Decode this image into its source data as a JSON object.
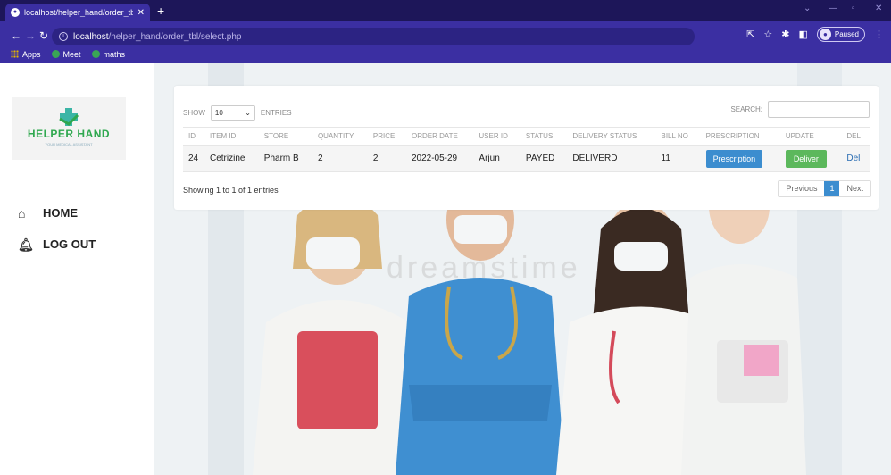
{
  "browser": {
    "tab_title": "localhost/helper_hand/order_tbl/s",
    "url_host": "localhost",
    "url_path": "/helper_hand/order_tbl/select.php",
    "profile_label": "Paused",
    "bookmarks": [
      {
        "label": "Apps",
        "icon": "apps-grid-icon"
      },
      {
        "label": "Meet",
        "icon": "meet-icon"
      },
      {
        "label": "maths",
        "icon": "maths-icon"
      }
    ],
    "colors": {
      "chrome": "#3b2fa2",
      "tabbar": "#1d1659"
    }
  },
  "sidebar": {
    "logo_text": "HELPER HAND",
    "logo_tagline": "YOUR MEDICAL ASSISTANT",
    "nav": [
      {
        "label": "HOME",
        "icon": "home-icon"
      },
      {
        "label": "LOG OUT",
        "icon": "bell-icon"
      }
    ]
  },
  "table_controls": {
    "show_label": "SHOW",
    "entries_value": "10",
    "entries_label": "ENTRIES",
    "search_label": "SEARCH:"
  },
  "table": {
    "headers": [
      "ID",
      "ITEM ID",
      "STORE",
      "QUANTITY",
      "PRICE",
      "ORDER DATE",
      "USER ID",
      "STATUS",
      "DELIVERY STATUS",
      "BILL NO",
      "PRESCRIPTION",
      "UPDATE",
      "DEL"
    ],
    "rows": [
      {
        "id": "24",
        "item_id": "Cetrizine",
        "store": "Pharm B",
        "quantity": "2",
        "price": "2",
        "order_date": "2022-05-29",
        "user_id": "Arjun",
        "status": "PAYED",
        "delivery_status": "DELIVERD",
        "bill_no": "11",
        "prescription": "Prescription",
        "update": "Deliver",
        "del": "Del"
      }
    ]
  },
  "pagination": {
    "info": "Showing 1 to 1 of 1 entries",
    "previous": "Previous",
    "current": "1",
    "next": "Next"
  },
  "hero": {
    "watermark": "dreamstime"
  },
  "colors": {
    "primary_button": "#3c8dcf",
    "success_button": "#5cb85c",
    "logo_green": "#2fa84f"
  }
}
